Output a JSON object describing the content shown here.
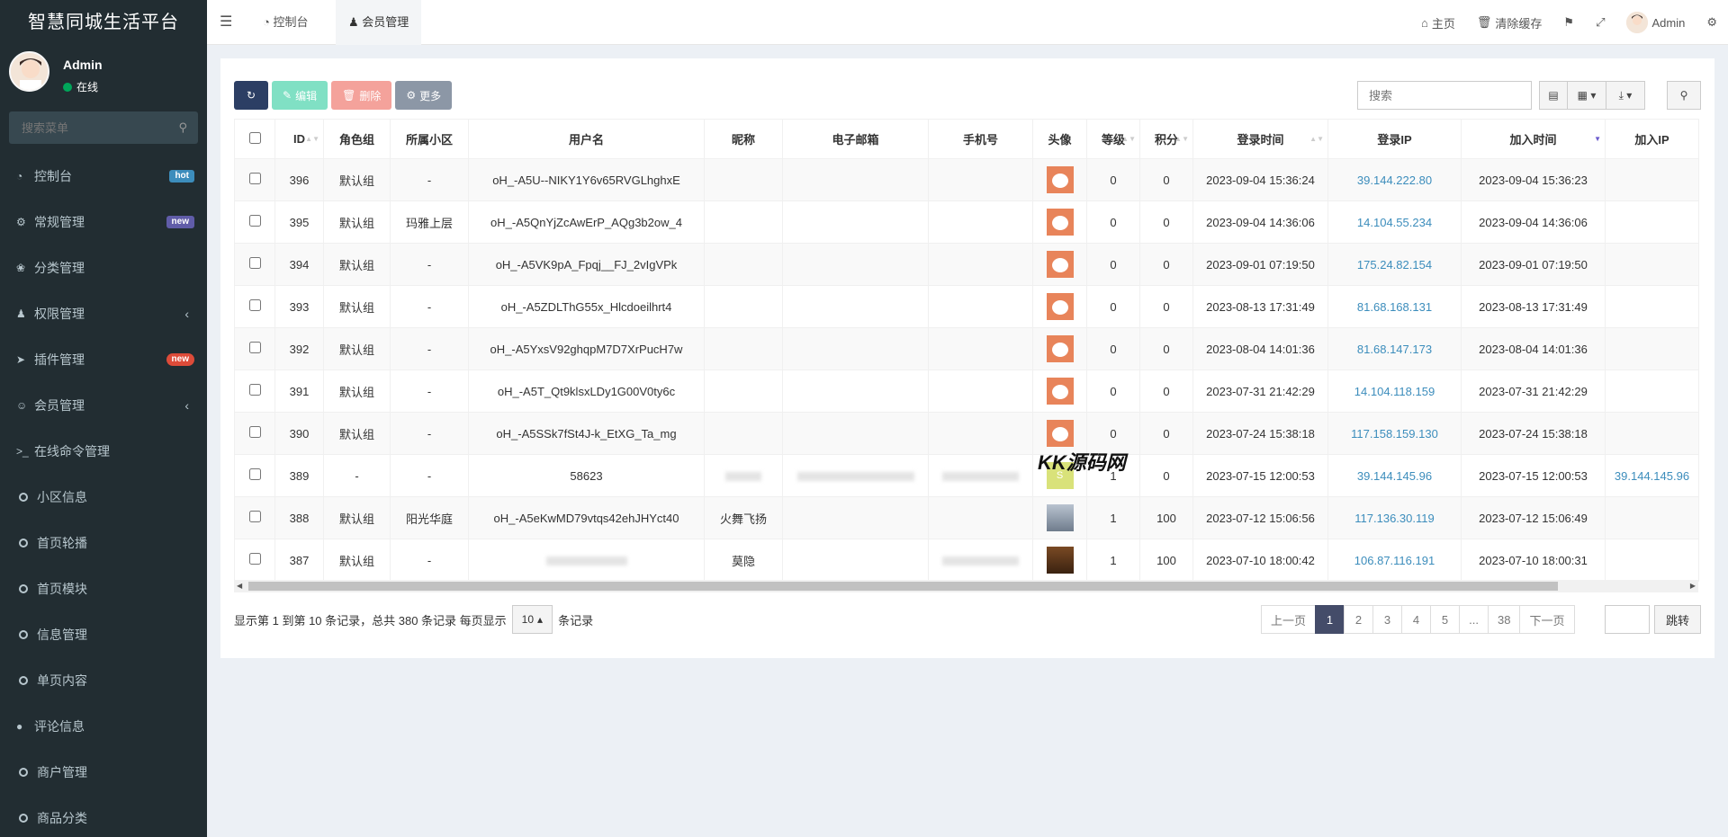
{
  "sidebar": {
    "brand": "智慧同城生活平台",
    "user": {
      "name": "Admin",
      "status": "在线"
    },
    "search_placeholder": "搜索菜单",
    "items": [
      {
        "label": "控制台",
        "icon": "dashboard-icon",
        "badge": "hot"
      },
      {
        "label": "常规管理",
        "icon": "cogs-icon",
        "badge": "new"
      },
      {
        "label": "分类管理",
        "icon": "leaf-icon"
      },
      {
        "label": "权限管理",
        "icon": "group-icon"
      },
      {
        "label": "插件管理",
        "icon": "rocket-icon",
        "badge": "new"
      },
      {
        "label": "会员管理",
        "icon": "user-circle-icon"
      },
      {
        "label": "在线命令管理",
        "icon": "terminal-icon"
      },
      {
        "label": "小区信息",
        "icon": "circle-o-icon"
      },
      {
        "label": "首页轮播",
        "icon": "circle-o-icon"
      },
      {
        "label": "首页模块",
        "icon": "circle-o-icon"
      },
      {
        "label": "信息管理",
        "icon": "circle-o-icon"
      },
      {
        "label": "单页内容",
        "icon": "circle-o-icon"
      },
      {
        "label": "评论信息",
        "icon": "comment-icon"
      },
      {
        "label": "商户管理",
        "icon": "circle-o-icon"
      },
      {
        "label": "商品分类",
        "icon": "circle-o-icon"
      }
    ]
  },
  "topnav": {
    "tabs": [
      {
        "label": "控制台"
      },
      {
        "label": "会员管理"
      }
    ],
    "home": "主页",
    "clear_cache": "清除缓存",
    "user": "Admin"
  },
  "toolbar": {
    "edit": "编辑",
    "delete": "删除",
    "more": "更多",
    "search_placeholder": "搜索"
  },
  "table": {
    "columns": [
      "ID",
      "角色组",
      "所属小区",
      "用户名",
      "昵称",
      "电子邮箱",
      "手机号",
      "头像",
      "等级",
      "积分",
      "登录时间",
      "登录IP",
      "加入时间",
      "加入IP"
    ],
    "rows": [
      {
        "id": "396",
        "group": "默认组",
        "community": "-",
        "username": "oH_-A5U--NIKY1Y6v65RVGLhghxE",
        "nickname": "",
        "level": "0",
        "score": "0",
        "login_time": "2023-09-04 15:36:24",
        "login_ip": "39.144.222.80",
        "join_time": "2023-09-04 15:36:23",
        "join_ip": ""
      },
      {
        "id": "395",
        "group": "默认组",
        "community": "玛雅上层",
        "username": "oH_-A5QnYjZcAwErP_AQg3b2ow_4",
        "nickname": "",
        "level": "0",
        "score": "0",
        "login_time": "2023-09-04 14:36:06",
        "login_ip": "14.104.55.234",
        "join_time": "2023-09-04 14:36:06",
        "join_ip": ""
      },
      {
        "id": "394",
        "group": "默认组",
        "community": "-",
        "username": "oH_-A5VK9pA_Fpqj__FJ_2vIgVPk",
        "nickname": "",
        "level": "0",
        "score": "0",
        "login_time": "2023-09-01 07:19:50",
        "login_ip": "175.24.82.154",
        "join_time": "2023-09-01 07:19:50",
        "join_ip": ""
      },
      {
        "id": "393",
        "group": "默认组",
        "community": "-",
        "username": "oH_-A5ZDLThG55x_Hlcdoeilhrt4",
        "nickname": "",
        "level": "0",
        "score": "0",
        "login_time": "2023-08-13 17:31:49",
        "login_ip": "81.68.168.131",
        "join_time": "2023-08-13 17:31:49",
        "join_ip": ""
      },
      {
        "id": "392",
        "group": "默认组",
        "community": "-",
        "username": "oH_-A5YxsV92ghqpM7D7XrPucH7w",
        "nickname": "",
        "level": "0",
        "score": "0",
        "login_time": "2023-08-04 14:01:36",
        "login_ip": "81.68.147.173",
        "join_time": "2023-08-04 14:01:36",
        "join_ip": ""
      },
      {
        "id": "391",
        "group": "默认组",
        "community": "-",
        "username": "oH_-A5T_Qt9klsxLDy1G00V0ty6c",
        "nickname": "",
        "level": "0",
        "score": "0",
        "login_time": "2023-07-31 21:42:29",
        "login_ip": "14.104.118.159",
        "join_time": "2023-07-31 21:42:29",
        "join_ip": ""
      },
      {
        "id": "390",
        "group": "默认组",
        "community": "-",
        "username": "oH_-A5SSk7fSt4J-k_EtXG_Ta_mg",
        "nickname": "",
        "level": "0",
        "score": "0",
        "login_time": "2023-07-24 15:38:18",
        "login_ip": "117.158.159.130",
        "join_time": "2023-07-24 15:38:18",
        "join_ip": ""
      },
      {
        "id": "389",
        "group": "-",
        "community": "-",
        "username": "58623",
        "nickname": "",
        "level": "1",
        "score": "0",
        "login_time": "2023-07-15 12:00:53",
        "login_ip": "39.144.145.96",
        "join_time": "2023-07-15 12:00:53",
        "join_ip": "39.144.145.96"
      },
      {
        "id": "388",
        "group": "默认组",
        "community": "阳光华庭",
        "username": "oH_-A5eKwMD79vtqs42ehJHYct40",
        "nickname": "火舞飞扬",
        "level": "1",
        "score": "100",
        "login_time": "2023-07-12 15:06:56",
        "login_ip": "117.136.30.119",
        "join_time": "2023-07-12 15:06:49",
        "join_ip": ""
      },
      {
        "id": "387",
        "group": "默认组",
        "community": "-",
        "username": "",
        "nickname": "莫隐",
        "level": "1",
        "score": "100",
        "login_time": "2023-07-10 18:00:42",
        "login_ip": "106.87.116.191",
        "join_time": "2023-07-10 18:00:31",
        "join_ip": ""
      }
    ]
  },
  "footer": {
    "info_prefix": "显示第 1 到第 10 条记录，总共 380 条记录 每页显示",
    "page_size": "10",
    "info_suffix": "条记录",
    "prev": "上一页",
    "pages": [
      "1",
      "2",
      "3",
      "4",
      "5",
      "...",
      "38"
    ],
    "next": "下一页",
    "jump": "跳转"
  },
  "watermark": "KK源码网",
  "colors": {
    "sidebar_bg": "#222d32",
    "accent": "#444c69",
    "link": "#3c8dbc"
  }
}
